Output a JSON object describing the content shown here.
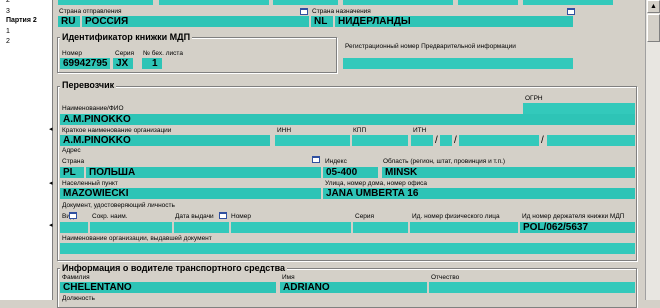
{
  "sidebar": {
    "items": [
      "2",
      "3",
      "Партия 2",
      "1",
      "2"
    ]
  },
  "route": {
    "origin_label": "Страна отправления",
    "origin_code": "RU",
    "origin_name": "РОССИЯ",
    "dest_label": "Страна назначения",
    "dest_code": "NL",
    "dest_name": "НИДЕРЛАНДЫ"
  },
  "tir": {
    "title": "Идентификатор книжки МДП",
    "number_label": "Номер",
    "series_label": "Серия",
    "sheet_label": "№ бех. листа",
    "number": "69942795",
    "series": "JX",
    "sheet": "1",
    "reg_label": "Регистрационный номер Предварительной информации"
  },
  "carrier": {
    "title": "Перевозчик",
    "ogrn_label": "ОГРН",
    "name_label": "Наименование/ФИО",
    "name": "A.M.PINOKKO",
    "short_label": "Краткое наименование организации",
    "short_name": "A.M.PINOKKO",
    "inn_label": "ИНН",
    "kpp_label": "КПП",
    "itn_label": "ИТН",
    "slash": "/",
    "address_label": "Адрес",
    "country_label": "Страна",
    "country_code": "PL",
    "country_name": "ПОЛЬША",
    "index_label": "Индекс",
    "index": "05-400",
    "region_label": "Область (регион, штат, провинция и т.п.)",
    "region": "MINSK",
    "city_label": "Населенный пункт",
    "city": "MAZOWIECKI",
    "street_label": "Улица, номер дома, номер офиса",
    "street": "JANA UMBERTA 16",
    "doc_label": "Документ, удостоверяющий личность",
    "doc_kind_label": "Вид",
    "doc_abbr_label": "Сокр. наим.",
    "doc_date_label": "Дата выдачи",
    "doc_num_label": "Номер",
    "doc_series_label": "Серия",
    "doc_person_label": "Ид. номер физического лица",
    "holder_label": "Ид номер держателя книжки МДП",
    "holder": "POL/062/5637",
    "issuer_label": "Наименование организации, выдавшей документ"
  },
  "driver": {
    "title": "Информация о водителе транспортного средства",
    "surname_label": "Фамилия",
    "surname": "CHELENTANO",
    "name_label": "Имя",
    "name": "ADRIANO",
    "patronymic_label": "Отчество",
    "position_label": "Должность"
  },
  "colors": {
    "field": "#2ec4b6",
    "panel": "#d4d0c8"
  }
}
